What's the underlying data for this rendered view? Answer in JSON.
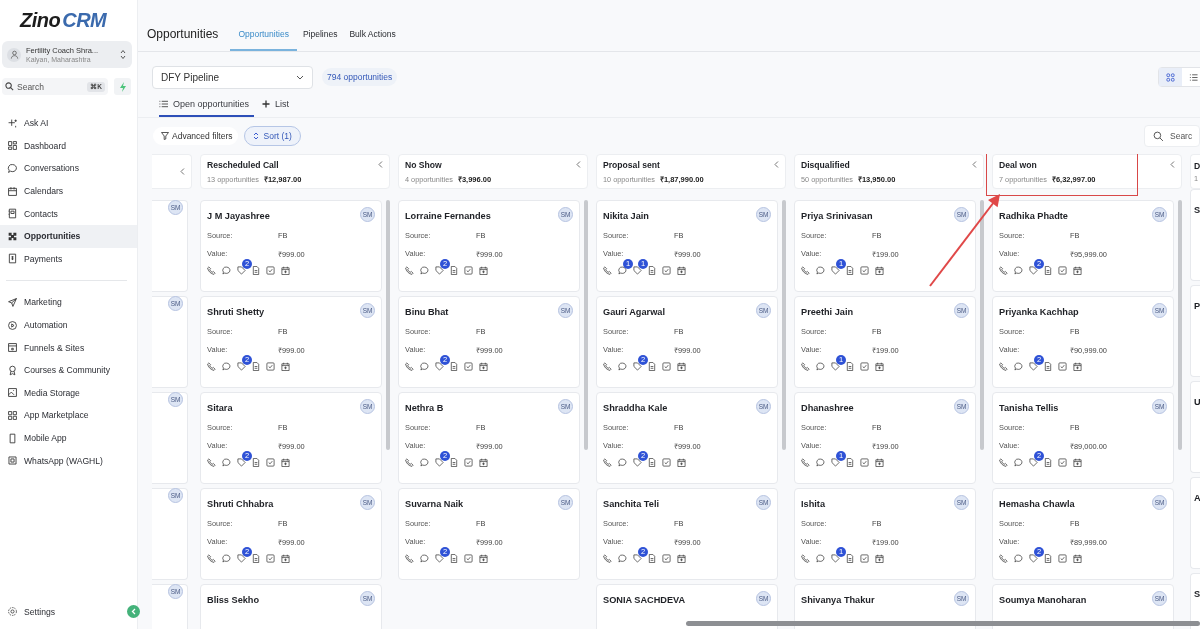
{
  "logo": {
    "word": "Zino",
    "accent": "CRM"
  },
  "account": {
    "name": "Fertility Coach Shra...",
    "location": "Kalyan, Maharashtra"
  },
  "search": {
    "placeholder": "Search",
    "shortcut": "⌘K"
  },
  "nav_main": [
    {
      "label": "Ask AI",
      "selected": false
    },
    {
      "label": "Dashboard",
      "selected": false
    },
    {
      "label": "Conversations",
      "selected": false
    },
    {
      "label": "Calendars",
      "selected": false
    },
    {
      "label": "Contacts",
      "selected": false
    },
    {
      "label": "Opportunities",
      "selected": true
    },
    {
      "label": "Payments",
      "selected": false
    }
  ],
  "nav_more": [
    {
      "label": "Marketing",
      "selected": false
    },
    {
      "label": "Automation",
      "selected": false
    },
    {
      "label": "Funnels & Sites",
      "selected": false
    },
    {
      "label": "Courses & Community",
      "selected": false
    },
    {
      "label": "Media Storage",
      "selected": false
    },
    {
      "label": "App Marketplace",
      "selected": false
    },
    {
      "label": "Mobile App",
      "selected": false
    },
    {
      "label": "WhatsApp (WAGHL)",
      "selected": false
    }
  ],
  "settings": {
    "label": "Settings"
  },
  "header": {
    "title": "Opportunities",
    "tabs": [
      {
        "label": "Opportunities",
        "selected": true
      },
      {
        "label": "Pipelines",
        "selected": false
      },
      {
        "label": "Bulk Actions",
        "selected": false
      }
    ]
  },
  "pipeline": {
    "value": "DFY Pipeline",
    "count": "794 opportunities"
  },
  "view_toggle": [
    {
      "selected": true
    },
    {
      "selected": false
    }
  ],
  "view_tabs": [
    {
      "label": "Open opportunities",
      "selected": true
    },
    {
      "label": "List",
      "selected": false
    }
  ],
  "filters": {
    "advanced": "Advanced filters",
    "sort": "Sort (1)",
    "search_placeholder": "Searc"
  },
  "board": {
    "left_stub": {
      "cards": [
        {
          "owner": "SM"
        },
        {
          "owner": "SM"
        },
        {
          "owner": "SM"
        },
        {
          "owner": "SM"
        },
        {
          "owner": "SM"
        }
      ]
    },
    "columns": [
      {
        "title": "Rescheduled Call",
        "count": "13 opportunities",
        "total": "₹12,987.00",
        "highlighted": false,
        "cards": [
          {
            "name": "J M Jayashree",
            "owner": "SM",
            "source_label": "Source:",
            "source": "FB",
            "value_label": "Value:",
            "value": "₹999.00",
            "tag_badge": "2"
          },
          {
            "name": "Shruti Shetty",
            "owner": "SM",
            "source_label": "Source:",
            "source": "FB",
            "value_label": "Value:",
            "value": "₹999.00",
            "tag_badge": "2"
          },
          {
            "name": "Sitara",
            "owner": "SM",
            "source_label": "Source:",
            "source": "FB",
            "value_label": "Value:",
            "value": "₹999.00",
            "tag_badge": "2"
          },
          {
            "name": "Shruti Chhabra",
            "owner": "SM",
            "source_label": "Source:",
            "source": "FB",
            "value_label": "Value:",
            "value": "₹999.00",
            "tag_badge": "2"
          },
          {
            "name": "Bliss Sekho",
            "owner": "SM"
          }
        ]
      },
      {
        "title": "No Show",
        "count": "4 opportunities",
        "total": "₹3,996.00",
        "highlighted": false,
        "cards": [
          {
            "name": "Lorraine Fernandes",
            "owner": "SM",
            "source_label": "Source:",
            "source": "FB",
            "value_label": "Value:",
            "value": "₹999.00",
            "tag_badge": "2"
          },
          {
            "name": "Binu Bhat",
            "owner": "SM",
            "source_label": "Source:",
            "source": "FB",
            "value_label": "Value:",
            "value": "₹999.00",
            "tag_badge": "2"
          },
          {
            "name": "Nethra B",
            "owner": "SM",
            "source_label": "Source:",
            "source": "FB",
            "value_label": "Value:",
            "value": "₹999.00",
            "tag_badge": "2"
          },
          {
            "name": "Suvarna Naik",
            "owner": "SM",
            "source_label": "Source:",
            "source": "FB",
            "value_label": "Value:",
            "value": "₹999.00",
            "tag_badge": "2"
          }
        ]
      },
      {
        "title": "Proposal sent",
        "count": "10 opportunities",
        "total": "₹1,87,990.00",
        "highlighted": false,
        "cards": [
          {
            "name": "Nikita Jain",
            "owner": "SM",
            "source_label": "Source:",
            "source": "FB",
            "value_label": "Value:",
            "value": "₹999.00",
            "chat_badge": "1",
            "tag_badge": "1"
          },
          {
            "name": "Gauri Agarwal",
            "owner": "SM",
            "source_label": "Source:",
            "source": "FB",
            "value_label": "Value:",
            "value": "₹999.00",
            "tag_badge": "2"
          },
          {
            "name": "Shraddha Kale",
            "owner": "SM",
            "source_label": "Source:",
            "source": "FB",
            "value_label": "Value:",
            "value": "₹999.00",
            "tag_badge": "2"
          },
          {
            "name": "Sanchita Teli",
            "owner": "SM",
            "source_label": "Source:",
            "source": "FB",
            "value_label": "Value:",
            "value": "₹999.00",
            "tag_badge": "2"
          },
          {
            "name": "SONIA SACHDEVA",
            "owner": "SM"
          }
        ]
      },
      {
        "title": "Disqualified",
        "count": "50 opportunities",
        "total": "₹13,950.00",
        "highlighted": false,
        "cards": [
          {
            "name": "Priya Srinivasan",
            "owner": "SM",
            "source_label": "Source:",
            "source": "FB",
            "value_label": "Value:",
            "value": "₹199.00",
            "tag_badge": "1"
          },
          {
            "name": "Preethi Jain",
            "owner": "SM",
            "source_label": "Source:",
            "source": "FB",
            "value_label": "Value:",
            "value": "₹199.00",
            "tag_badge": "1"
          },
          {
            "name": "Dhanashree",
            "owner": "SM",
            "source_label": "Source:",
            "source": "FB",
            "value_label": "Value:",
            "value": "₹199.00",
            "tag_badge": "1"
          },
          {
            "name": "Ishita",
            "owner": "SM",
            "source_label": "Source:",
            "source": "FB",
            "value_label": "Value:",
            "value": "₹199.00",
            "tag_badge": "1"
          },
          {
            "name": "Shivanya Thakur",
            "owner": "SM"
          }
        ]
      },
      {
        "title": "Deal won",
        "count": "7 opportunities",
        "total": "₹6,32,997.00",
        "highlighted": true,
        "cards": [
          {
            "name": "Radhika Phadte",
            "owner": "SM",
            "source_label": "Source:",
            "source": "FB",
            "value_label": "Value:",
            "value": "₹95,999.00",
            "tag_badge": "2"
          },
          {
            "name": "Priyanka Kachhap",
            "owner": "SM",
            "source_label": "Source:",
            "source": "FB",
            "value_label": "Value:",
            "value": "₹90,999.00",
            "tag_badge": "2"
          },
          {
            "name": "Tanisha Tellis",
            "owner": "SM",
            "source_label": "Source:",
            "source": "FB",
            "value_label": "Value:",
            "value": "₹89,000.00",
            "tag_badge": "2"
          },
          {
            "name": "Hemasha Chawla",
            "owner": "SM",
            "source_label": "Source:",
            "source": "FB",
            "value_label": "Value:",
            "value": "₹89,999.00",
            "tag_badge": "2"
          },
          {
            "name": "Soumya Manoharan",
            "owner": "SM"
          }
        ]
      }
    ],
    "right_stub": {
      "title": "D",
      "count": "1",
      "cards": [
        {
          "name": "S"
        },
        {
          "name": "P"
        },
        {
          "name": "U"
        },
        {
          "name": "A"
        },
        {
          "name": "S"
        }
      ]
    }
  }
}
